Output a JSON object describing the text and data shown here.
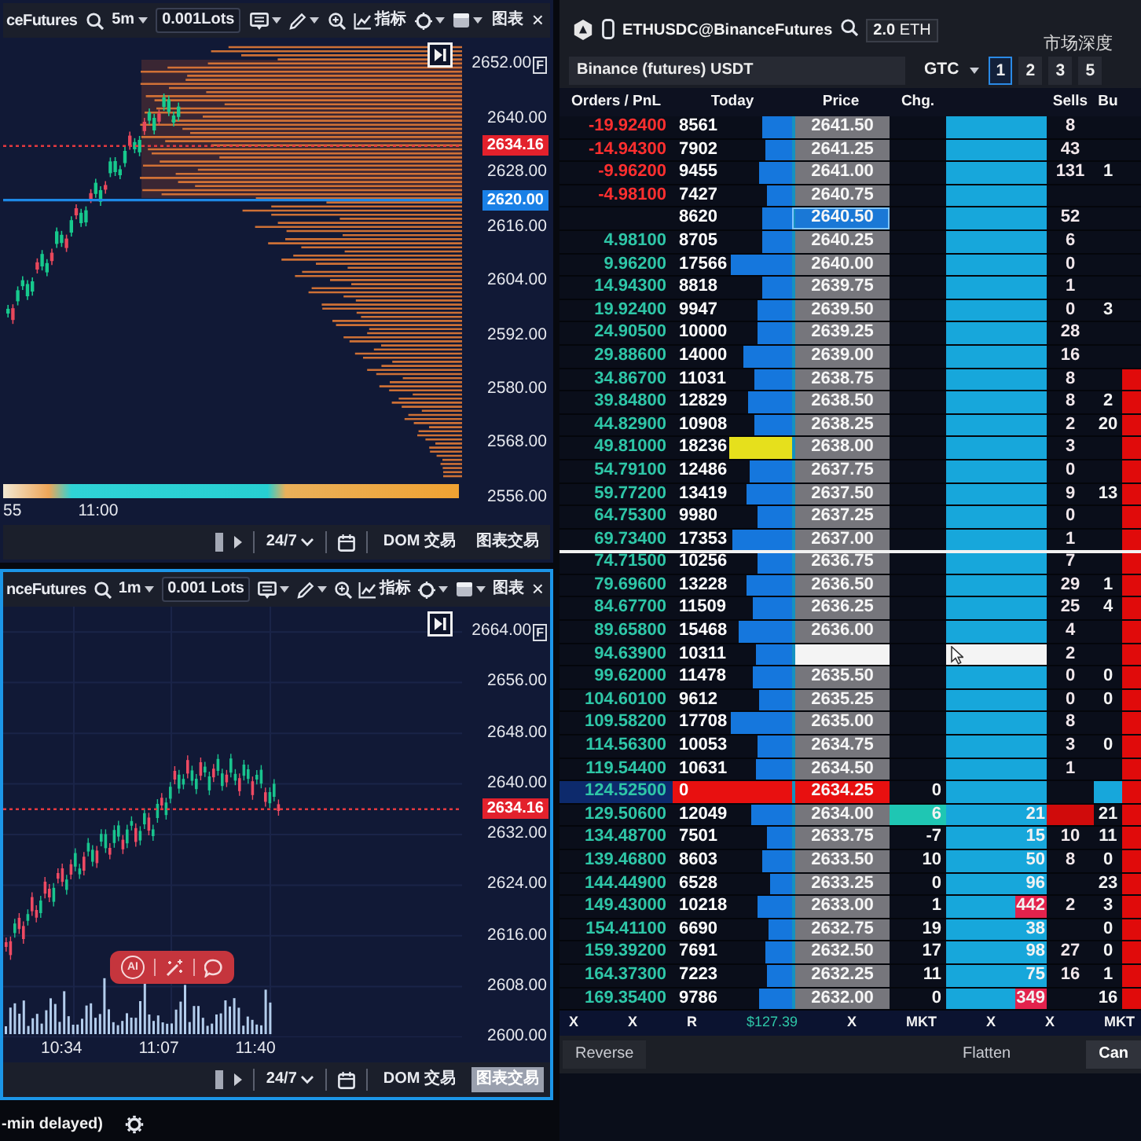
{
  "charts": [
    {
      "kind": "profile",
      "selected": false,
      "symbol": "ceFutures",
      "interval": "5m",
      "lots": "0.001Lots",
      "indicators": "指标",
      "layout": "图表",
      "close": "×",
      "axis_badge": "F",
      "axis": [
        {
          "kind": "tick",
          "text": "2652.00"
        },
        {
          "kind": "tick",
          "text": "2640.00"
        },
        {
          "kind": "last",
          "text": "2634.16"
        },
        {
          "kind": "tick",
          "text": "2628.00"
        },
        {
          "kind": "line",
          "text": "2620.00"
        },
        {
          "kind": "tick",
          "text": "2616.00"
        },
        {
          "kind": "tick",
          "text": "2604.00"
        },
        {
          "kind": "tick",
          "text": "2592.00"
        },
        {
          "kind": "tick",
          "text": "2580.00"
        },
        {
          "kind": "tick",
          "text": "2568.00"
        },
        {
          "kind": "tick",
          "text": "2556.00"
        }
      ],
      "times": [
        "55",
        "11:00"
      ],
      "session": "24/7",
      "buttons": [
        {
          "label": "DOM 交易",
          "selected": false
        },
        {
          "label": "图表交易",
          "selected": false
        }
      ]
    },
    {
      "kind": "volume",
      "selected": true,
      "symbol": "nceFutures",
      "interval": "1m",
      "lots": "0.001 Lots",
      "indicators": "指标",
      "layout": "图表",
      "close": "×",
      "axis_badge": "F",
      "ai_label": "AI",
      "axis": [
        {
          "kind": "tick",
          "text": "2664.00"
        },
        {
          "kind": "tick",
          "text": "2656.00"
        },
        {
          "kind": "tick",
          "text": "2648.00"
        },
        {
          "kind": "tick",
          "text": "2640.00"
        },
        {
          "kind": "last",
          "text": "2634.16"
        },
        {
          "kind": "tick",
          "text": "2632.00"
        },
        {
          "kind": "tick",
          "text": "2624.00"
        },
        {
          "kind": "tick",
          "text": "2616.00"
        },
        {
          "kind": "tick",
          "text": "2608.00"
        },
        {
          "kind": "tick",
          "text": "2600.00"
        }
      ],
      "times": [
        "10:34",
        "11:07",
        "11:40"
      ],
      "session": "24/7",
      "buttons": [
        {
          "label": "DOM 交易",
          "selected": false
        },
        {
          "label": "图表交易",
          "selected": true
        }
      ]
    }
  ],
  "status": "-min delayed)",
  "dom": {
    "symbol": "ETHUSDC@BinanceFutures",
    "quantity": "**2.0** ETH",
    "title": "市场深度",
    "account": "Binance (futures) USDT",
    "tif": "GTC",
    "presets": [
      {
        "label": "1",
        "selected": true
      },
      {
        "label": "2",
        "selected": false
      },
      {
        "label": "3",
        "selected": false
      },
      {
        "label": "5",
        "selected": false
      }
    ],
    "columns": [
      {
        "kind": "pnl",
        "label": "Orders / PnL"
      },
      {
        "kind": "today",
        "label": "Today"
      },
      {
        "kind": "price",
        "label": "Price"
      },
      {
        "kind": "chg",
        "label": "Chg."
      },
      {
        "kind": "sells",
        "label": "Sells"
      },
      {
        "kind": "buys",
        "label": "Bu"
      }
    ],
    "rows": [
      {
        "pnl": "-19.92400",
        "today": "8561",
        "price": "2641.50",
        "kind": "loss",
        "filled": false,
        "sells": "8"
      },
      {
        "pnl": "-14.94300",
        "today": "7902",
        "price": "2641.25",
        "kind": "loss",
        "filled": false,
        "sells": "43"
      },
      {
        "pnl": "-9.96200",
        "today": "9455",
        "price": "2641.00",
        "kind": "loss",
        "filled": false,
        "sells": "131",
        "buys": "1"
      },
      {
        "pnl": "-4.98100",
        "today": "7427",
        "price": "2640.75",
        "kind": "loss",
        "filled": false
      },
      {
        "today": "8620",
        "price": "2640.50",
        "kind": "marked",
        "filled": false,
        "sells": "52"
      },
      {
        "pnl": "4.98100",
        "today": "8705",
        "price": "2640.25",
        "kind": "plain",
        "filled": false,
        "sells": "6"
      },
      {
        "pnl": "9.96200",
        "today": "17566",
        "price": "2640.00",
        "kind": "plain",
        "filled": false,
        "sells": "0"
      },
      {
        "pnl": "14.94300",
        "today": "8818",
        "price": "2639.75",
        "kind": "plain",
        "filled": false,
        "sells": "1"
      },
      {
        "pnl": "19.92400",
        "today": "9947",
        "price": "2639.50",
        "kind": "plain",
        "filled": false,
        "sells": "0",
        "buys": "3"
      },
      {
        "pnl": "24.90500",
        "today": "10000",
        "price": "2639.25",
        "kind": "plain",
        "filled": false,
        "sells": "28"
      },
      {
        "pnl": "29.88600",
        "today": "14000",
        "price": "2639.00",
        "kind": "plain",
        "filled": false,
        "sells": "16"
      },
      {
        "pnl": "34.86700",
        "today": "11031",
        "price": "2638.75",
        "kind": "plain",
        "filled": true,
        "sells": "8"
      },
      {
        "pnl": "39.84800",
        "today": "12829",
        "price": "2638.50",
        "kind": "plain",
        "filled": true,
        "sells": "8",
        "buys": "2"
      },
      {
        "pnl": "44.82900",
        "today": "10908",
        "price": "2638.25",
        "kind": "plain",
        "filled": true,
        "sells": "2",
        "buys": "20"
      },
      {
        "pnl": "49.81000",
        "today": "18236",
        "price": "2638.00",
        "kind": "peak",
        "filled": true,
        "sells": "3"
      },
      {
        "pnl": "54.79100",
        "today": "12486",
        "price": "2637.75",
        "kind": "plain",
        "filled": true,
        "sells": "0"
      },
      {
        "pnl": "59.77200",
        "today": "13419",
        "price": "2637.50",
        "kind": "plain",
        "filled": true,
        "sells": "9",
        "buys": "13"
      },
      {
        "pnl": "64.75300",
        "today": "9980",
        "price": "2637.25",
        "kind": "plain",
        "filled": true,
        "sells": "0"
      },
      {
        "pnl": "69.73400",
        "today": "17353",
        "price": "2637.00",
        "kind": "divider",
        "filled": true,
        "sells": "1"
      },
      {
        "pnl": "74.71500",
        "today": "10256",
        "price": "2636.75",
        "kind": "plain",
        "filled": true,
        "sells": "7"
      },
      {
        "pnl": "79.69600",
        "today": "13228",
        "price": "2636.50",
        "kind": "plain",
        "filled": true,
        "sells": "29",
        "buys": "1"
      },
      {
        "pnl": "84.67700",
        "today": "11509",
        "price": "2636.25",
        "kind": "plain",
        "filled": true,
        "sells": "25",
        "buys": "4"
      },
      {
        "pnl": "89.65800",
        "today": "15468",
        "price": "2636.00",
        "kind": "plain",
        "filled": true,
        "sells": "4"
      },
      {
        "pnl": "94.63900",
        "today": "10311",
        "kind": "hover",
        "filled": true,
        "sells": "2"
      },
      {
        "pnl": "99.62000",
        "today": "11478",
        "price": "2635.50",
        "kind": "plain",
        "filled": true,
        "sells": "0",
        "buys": "0"
      },
      {
        "pnl": "104.60100",
        "today": "9612",
        "price": "2635.25",
        "kind": "plain",
        "filled": true,
        "sells": "0",
        "buys": "0"
      },
      {
        "pnl": "109.58200",
        "today": "17708",
        "price": "2635.00",
        "kind": "plain",
        "filled": true,
        "sells": "8"
      },
      {
        "pnl": "114.56300",
        "today": "10053",
        "price": "2634.75",
        "kind": "plain",
        "filled": true,
        "sells": "3",
        "buys": "0"
      },
      {
        "pnl": "119.54400",
        "today": "10631",
        "price": "2634.50",
        "kind": "plain",
        "filled": true,
        "sells": "1"
      },
      {
        "pnl": "124.52500",
        "today": "0",
        "price": "2634.25",
        "kind": "current",
        "filled": true,
        "chg": "0"
      },
      {
        "pnl": "129.50600",
        "today": "12049",
        "price": "2634.00",
        "kind": "trade",
        "filled": true,
        "chg": "6",
        "vol": "21",
        "buys": "21"
      },
      {
        "pnl": "134.48700",
        "today": "7501",
        "price": "2633.75",
        "kind": "plain",
        "filled": true,
        "chg": "-7",
        "vol": "15",
        "sells": "10",
        "buys": "11"
      },
      {
        "pnl": "139.46800",
        "today": "8603",
        "price": "2633.50",
        "kind": "plain",
        "filled": true,
        "chg": "10",
        "vol": "50",
        "sells": "8",
        "buys": "0"
      },
      {
        "pnl": "144.44900",
        "today": "6528",
        "price": "2633.25",
        "kind": "plain",
        "filled": true,
        "chg": "0",
        "vol": "96",
        "buys": "23"
      },
      {
        "pnl": "149.43000",
        "today": "10218",
        "price": "2633.00",
        "kind": "alert",
        "filled": true,
        "chg": "1",
        "vol": "442",
        "sells": "2",
        "buys": "3"
      },
      {
        "pnl": "154.41100",
        "today": "6690",
        "price": "2632.75",
        "kind": "plain",
        "filled": true,
        "chg": "19",
        "vol": "38",
        "buys": "0"
      },
      {
        "pnl": "159.39200",
        "today": "7691",
        "price": "2632.50",
        "kind": "plain",
        "filled": true,
        "chg": "17",
        "vol": "98",
        "sells": "27",
        "buys": "0"
      },
      {
        "pnl": "164.37300",
        "today": "7223",
        "price": "2632.25",
        "kind": "plain",
        "filled": true,
        "chg": "11",
        "vol": "75",
        "sells": "16",
        "buys": "1"
      },
      {
        "pnl": "169.35400",
        "today": "9786",
        "price": "2632.00",
        "kind": "alert",
        "filled": true,
        "chg": "0",
        "vol": "349",
        "buys": "16"
      }
    ],
    "footer": [
      {
        "text": "X",
        "kind": "action"
      },
      {
        "text": "X",
        "kind": "action"
      },
      {
        "text": "R",
        "kind": "action"
      },
      {
        "text": "$127.39",
        "kind": "amount"
      },
      {
        "text": "X",
        "kind": "action"
      },
      {
        "text": "MKT",
        "kind": "action"
      },
      {
        "text": "X",
        "kind": "action"
      },
      {
        "text": "X",
        "kind": "action"
      },
      {
        "text": "MKT",
        "kind": "action"
      }
    ],
    "actions": [
      "Reverse",
      "Flatten",
      "Can"
    ]
  }
}
